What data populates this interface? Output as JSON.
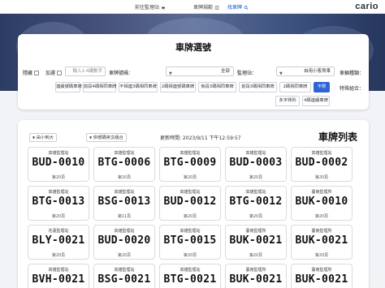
{
  "header": {
    "logo": "cario",
    "nav": [
      {
        "label": "找車牌",
        "active": true
      },
      {
        "label": "車牌規範",
        "active": false
      },
      {
        "label": "前往監理站",
        "active": false
      }
    ]
  },
  "filter": {
    "title": "車牌選號",
    "vehicle_type_label": "車輛種類：",
    "vehicle_type_value": "自用小客貨車",
    "station_label": "監理站：",
    "station_value": "全部",
    "number_label": "車牌號碼：",
    "number_placeholder": "輸入1-4碼數字",
    "checkbox_hide_label": "隱藏",
    "checkbox_other_label": "加選",
    "special_label": "特殊組合：",
    "chips": [
      {
        "label": "不限",
        "active": true
      },
      {
        "label": "2碼相同車牌",
        "active": false
      },
      {
        "label": "前段3碼相同車牌",
        "active": false
      },
      {
        "label": "後段3碼相同車牌",
        "active": false
      },
      {
        "label": "2碼相連號碼車牌",
        "active": false
      },
      {
        "label": "不相連3碼相同車牌",
        "active": false
      },
      {
        "label": "前段4碼相同車牌",
        "active": false
      },
      {
        "label": "連續號碼車牌",
        "active": false
      }
    ],
    "chips_row2": [
      {
        "label": "4碼連續車牌",
        "active": false
      },
      {
        "label": "多字排列",
        "active": false
      }
    ]
  },
  "list": {
    "title": "車牌列表",
    "updated": "更新時間: 2023/9/11 下午12:59:57",
    "sort_value": "由小到大",
    "sort2_value": "依號碼英文組合",
    "cards": [
      {
        "station": "高雄監理站",
        "plate": "BUD-0002",
        "count": "第20頁"
      },
      {
        "station": "高雄監理站",
        "plate": "BUD-0003",
        "count": "第20頁"
      },
      {
        "station": "高雄監理站",
        "plate": "BTG-0009",
        "count": "第20頁"
      },
      {
        "station": "高雄監理站",
        "plate": "BTG-0006",
        "count": "第20頁"
      },
      {
        "station": "高雄監理站",
        "plate": "BUD-0010",
        "count": "第20頁"
      },
      {
        "station": "臺南監理所",
        "plate": "BUK-0010",
        "count": "第20頁"
      },
      {
        "station": "高雄監理站",
        "plate": "BTG-0012",
        "count": "第20頁"
      },
      {
        "station": "高雄監理站",
        "plate": "BUD-0012",
        "count": "第20頁"
      },
      {
        "station": "高雄監理站",
        "plate": "BSG-0013",
        "count": "第11頁"
      },
      {
        "station": "高雄監理站",
        "plate": "BTG-0013",
        "count": "第20頁"
      },
      {
        "station": "臺南監理所",
        "plate": "BUK-0021",
        "count": "第20頁"
      },
      {
        "station": "臺南監理所",
        "plate": "BUK-0021",
        "count": "第20頁"
      },
      {
        "station": "高雄監理站",
        "plate": "BTG-0015",
        "count": "第20頁"
      },
      {
        "station": "高雄監理站",
        "plate": "BUD-0020",
        "count": "第20頁"
      },
      {
        "station": "花蓮監理站",
        "plate": "BLY-0021",
        "count": "第20頁"
      },
      {
        "station": "臺南監理所",
        "plate": "BUK-0021",
        "count": "第20頁"
      },
      {
        "station": "臺南監理所",
        "plate": "BUK-0021",
        "count": "第20頁"
      },
      {
        "station": "高雄監理站",
        "plate": "BTG-0021",
        "count": "第20頁"
      },
      {
        "station": "高雄監理站",
        "plate": "BSG-0021",
        "count": "第20頁"
      },
      {
        "station": "高雄監理站",
        "plate": "BVH-0021",
        "count": "第20頁"
      }
    ]
  },
  "colors": {
    "accent": "#2e63d6",
    "hero": "#3e5281"
  },
  "icons": [
    "search-icon",
    "book-icon",
    "car-icon",
    "chevron-down-icon"
  ]
}
